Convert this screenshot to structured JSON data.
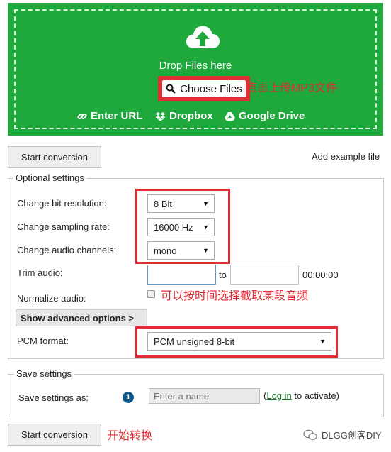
{
  "upload": {
    "drop_text": "Drop Files here",
    "choose_label": "Choose Files",
    "choose_annotation": "点击上传MP3文件",
    "sources": [
      {
        "label": "Enter URL",
        "icon": "link-icon"
      },
      {
        "label": "Dropbox",
        "icon": "dropbox-icon"
      },
      {
        "label": "Google Drive",
        "icon": "google-drive-icon"
      }
    ],
    "bg_color": "#1fa83c"
  },
  "actions": {
    "start_label": "Start conversion",
    "example_label": "Add example file",
    "start_annotation": "开始转换"
  },
  "optional": {
    "legend": "Optional settings",
    "bit_resolution": {
      "label": "Change bit resolution:",
      "value": "8 Bit"
    },
    "sampling_rate": {
      "label": "Change sampling rate:",
      "value": "16000 Hz"
    },
    "channels": {
      "label": "Change audio channels:",
      "value": "mono"
    },
    "trim": {
      "label": "Trim audio:",
      "start_value": "",
      "to_label": "to",
      "end_value": "",
      "time": "00:00:00"
    },
    "normalize": {
      "label": "Normalize audio:",
      "checked": false
    },
    "trim_annotation": "可以按时间选择截取某段音频",
    "advanced_label": "Show advanced options >",
    "pcm": {
      "label": "PCM format:",
      "value": "PCM unsigned 8-bit"
    }
  },
  "save": {
    "legend": "Save settings",
    "label": "Save settings as:",
    "placeholder": "Enter a name",
    "login_prefix": "(",
    "login_link": "Log in",
    "login_suffix": " to activate)"
  },
  "watermark": {
    "text": "DLGG创客DIY"
  },
  "colors": {
    "accent_red": "#e12c33",
    "link_green": "#1a7a2a",
    "info_blue": "#0e5a8a"
  }
}
